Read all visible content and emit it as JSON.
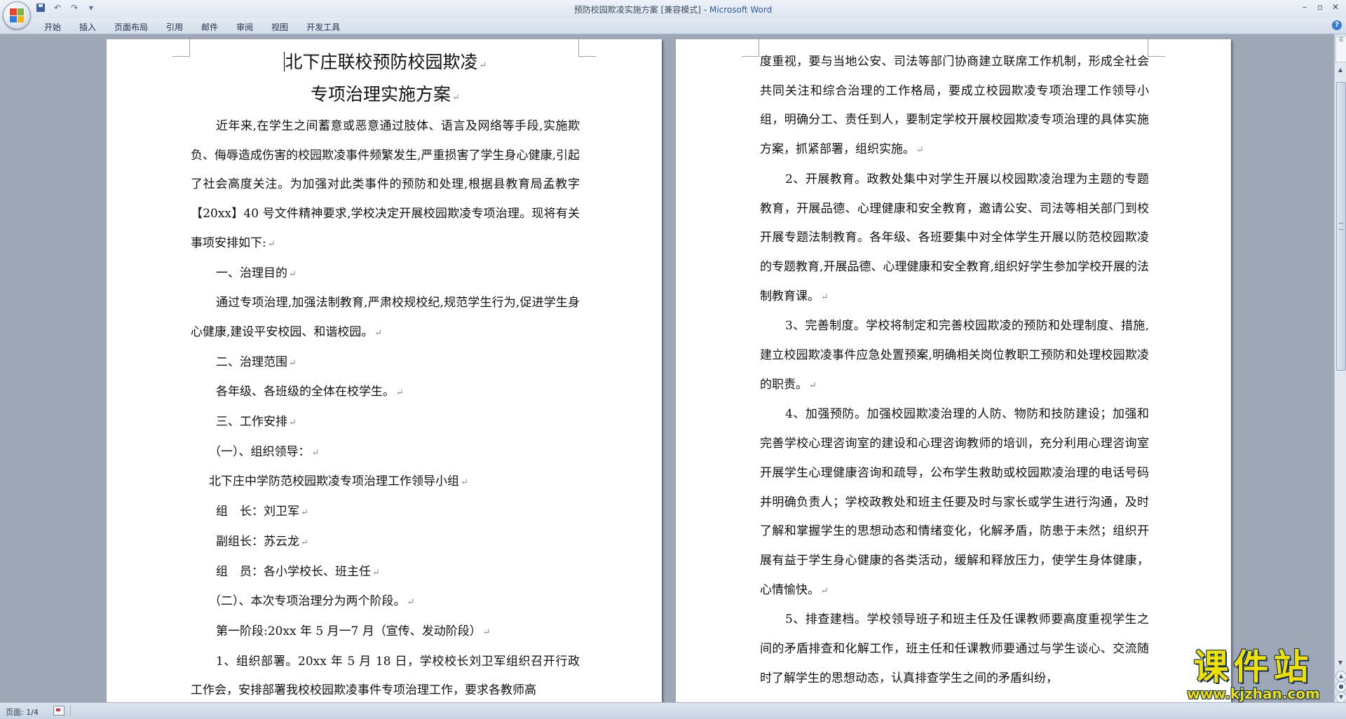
{
  "window": {
    "title_doc": "预防校园欺凌实施方案 [兼容模式] - ",
    "title_app": "Microsoft Word"
  },
  "ribbon": {
    "tabs": [
      "开始",
      "插入",
      "页面布局",
      "引用",
      "邮件",
      "审阅",
      "视图",
      "开发工具"
    ]
  },
  "document": {
    "title_line1": "北下庄联校预防校园欺凌",
    "title_line2": "专项治理实施方案",
    "left_page": [
      "近年来,在学生之间蓄意或恶意通过肢体、语言及网络等手段,实施欺负、侮辱造成伤害的校园欺凌事件频繁发生,严重损害了学生身心健康,引起了社会高度关注。为加强对此类事件的预防和处理,根据县教育局孟教字【20xx】40 号文件精神要求,学校决定开展校园欺凌专项治理。现将有关事项安排如下:",
      "一、治理目的",
      "通过专项治理,加强法制教育,严肃校规校纪,规范学生行为,促进学生身心健康,建设平安校园、和谐校园。",
      "二、治理范围",
      "各年级、各班级的全体在校学生。",
      "三、工作安排",
      "（一）、组织领导：",
      "北下庄中学防范校园欺凌专项治理工作领导小组",
      "组　长：刘卫军",
      "副组长：苏云龙",
      "组　员：各小学校长、班主任",
      "（二）、本次专项治理分为两个阶段。",
      "第一阶段:20xx 年 5 月一7 月（宣传、发动阶段）",
      "1、组织部署。20xx 年 5 月 18 日，学校校长刘卫军组织召开行政工作会，安排部署我校校园欺凌事件专项治理工作，要求各教师高"
    ],
    "right_page": [
      "度重视，要与当地公安、司法等部门协商建立联席工作机制，形成全社会共同关注和综合治理的工作格局，要成立校园欺凌专项治理工作领导小组，明确分工、责任到人，要制定学校开展校园欺凌专项治理的具体实施方案，抓紧部署，组织实施。",
      "2、开展教育。政教处集中对学生开展以校园欺凌治理为主题的专题教育，开展品德、心理健康和安全教育，邀请公安、司法等相关部门到校开展专题法制教育。各年级、各班要集中对全体学生开展以防范校园欺凌的专题教育,开展品德、心理健康和安全教育,组织好学生参加学校开展的法制教育课。",
      "3、完善制度。学校将制定和完善校园欺凌的预防和处理制度、措施,建立校园欺凌事件应急处置预案,明确相关岗位教职工预防和处理校园欺凌的职责。",
      "4、加强预防。加强校园欺凌治理的人防、物防和技防建设；加强和完善学校心理咨询室的建设和心理咨询教师的培训，充分利用心理咨询室开展学生心理健康咨询和疏导，公布学生救助或校园欺凌治理的电话号码并明确负责人；学校政教处和班主任要及时与家长或学生进行沟通，及时了解和掌握学生的思想动态和情绪变化，化解矛盾，防患于未然；组织开展有益于学生身心健康的各类活动，缓解和释放压力，使学生身体健康，心情愉快。",
      "5、排查建档。学校领导班子和班主任及任课教师要高度重视学生之间的矛盾排查和化解工作，班主任和任课教师要通过与学生谈心、交流随时了解学生的思想动态，认真排查学生之间的矛盾纠纷，"
    ],
    "paragraph_mark": "↵"
  },
  "status": {
    "page": "页面: 1/4"
  },
  "watermark": {
    "main": "课件站",
    "url": "www.kjzhan.com"
  },
  "icons": {
    "save": "save-icon",
    "undo": "undo-icon",
    "redo": "redo-icon",
    "help": "help-icon"
  },
  "colors": {
    "workspace": "#9da7b6",
    "title_app": "#2d5aa8",
    "watermark": "#f0e000"
  }
}
